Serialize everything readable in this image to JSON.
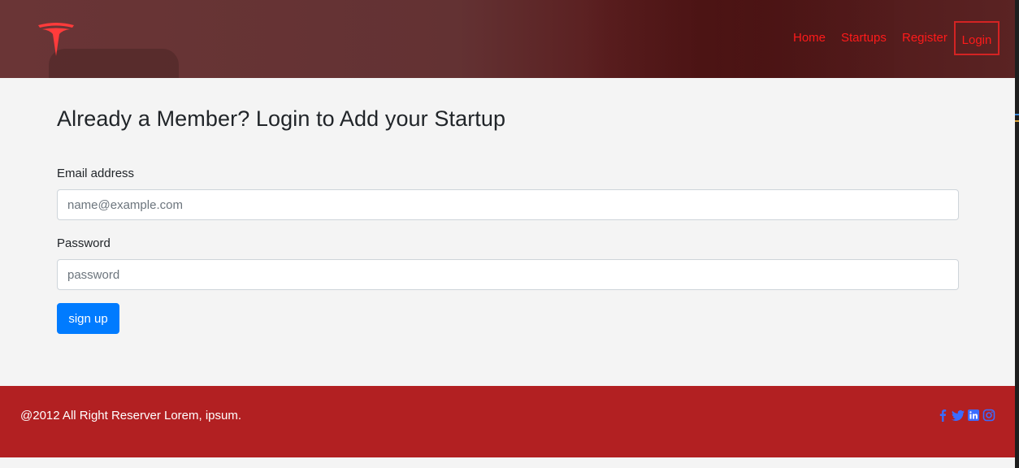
{
  "colors": {
    "header_bg": "#633233",
    "nav_link": "#ff1a1a",
    "login_border": "#d42323",
    "primary_button": "#007bff",
    "footer_bg": "#b22022",
    "social_icon": "#3b6cff"
  },
  "header": {
    "logo_icon": "tesla-logo-icon",
    "nav": {
      "home": "Home",
      "startups": "Startups",
      "register": "Register",
      "login": "Login"
    }
  },
  "main": {
    "title": "Already a Member? Login to Add your Startup",
    "email": {
      "label": "Email address",
      "placeholder": "name@example.com",
      "value": ""
    },
    "password": {
      "label": "Password",
      "placeholder": "password",
      "value": ""
    },
    "submit_label": "sign up"
  },
  "footer": {
    "copyright": "@2012 All Right Reserver Lorem, ipsum.",
    "social_icons": [
      "facebook-icon",
      "twitter-icon",
      "linkedin-icon",
      "instagram-icon"
    ]
  }
}
